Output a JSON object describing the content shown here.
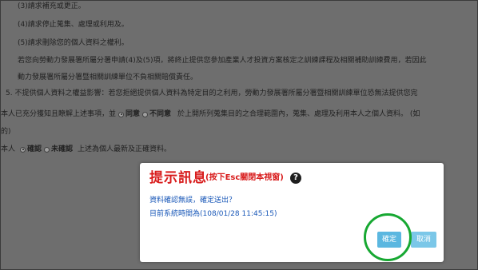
{
  "document": {
    "lines": [
      "(3)請求補充或更正。",
      "(4)請求停止蒐集、處理或利用及。",
      "(5)請求刪除您的個人資料之權利。",
      "若您向勞動力發展署所屬分署申請(4)及(5)項，將終止提供您參加產業人才投資方案核定之訓練課程及相關補助訓練費用，若因此",
      "動力發展署所屬分署暨相關訓練單位不負相關賠償責任。",
      "5. 不提供個人資料之權益影響：若您拒絕提供個人資料為特定目的之利用，勞動力發展署所屬分署暨相關訓練單位恐無法提供您完"
    ],
    "consent": {
      "prefix": "本人已充分獲知且瞭解上述事項，並",
      "agree_label": "同意",
      "disagree_label": "不同意",
      "suffix": "於上開所列蒐集目的之合理範圍內，蒐集、處理及利用本人之個人資料。 (如"
    },
    "fragment": "的)",
    "confirm": {
      "prefix": "本人",
      "confirm_label": "確認",
      "not_confirm_label": "未確認",
      "suffix": "上述為個人最新及正確資料。"
    }
  },
  "dialog": {
    "title": "提示訊息",
    "hint": "(按下Esc關閉本視窗)",
    "help_icon": "question-circle-icon",
    "message": "資料確認無誤，確定送出？",
    "system_time": "目前系統時間為(108/01/28 11:45:15)",
    "ok_label": "確定",
    "cancel_label": "取消"
  },
  "colors": {
    "title_red": "#d81b1b",
    "message_blue": "#1a58b8",
    "button_blue": "#5bb7e0",
    "highlight_green": "#17a832"
  }
}
